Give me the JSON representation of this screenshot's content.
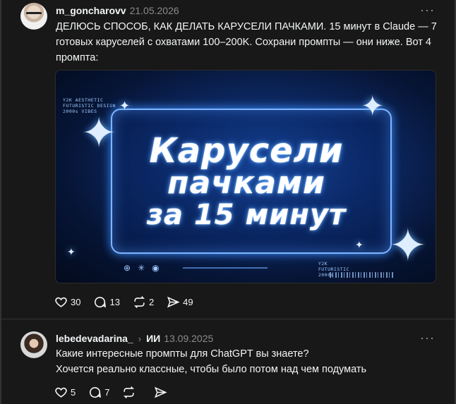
{
  "posts": [
    {
      "username": "m_goncharovv",
      "date": "21.05.2026",
      "text": "ДЕЛЮСЬ СПОСОБ, КАК ДЕЛАТЬ КАРУСЕЛИ ПАЧКАМИ. 15 минут в Claude — 7 готовых каруселей с охватами 100–200K. Сохрани промпты — они ниже. Вот 4 промпта:",
      "image": {
        "caption_top": "Y2K AESTHETIC\nFUTURISTIC DESIGN\n2000s VIBES",
        "line1": "Карусели",
        "line2": "пачками",
        "line3": "за 15 минут",
        "caption_bottom": "Y2K\nFUTURISTIC\n2000s"
      },
      "actions": {
        "likes": "30",
        "comments": "13",
        "reposts": "2",
        "shares": "49"
      }
    },
    {
      "username": "lebedevadarina_",
      "reply_to": "ИИ",
      "date": "13.09.2025",
      "text_line1": "Какие интересные промпты для ChatGPT вы знаете?",
      "text_line2": "Хочется реально классные, чтобы было потом над чем подумать",
      "actions": {
        "likes": "5",
        "comments": "7",
        "reposts": "",
        "shares": ""
      }
    }
  ],
  "icons": {
    "more": "more-horizontal-icon",
    "like": "heart-icon",
    "comment": "comment-icon",
    "repost": "repost-icon",
    "share": "send-icon"
  },
  "colors": {
    "background": "#181818",
    "text": "#f3f5f7",
    "muted": "#8a8a8a",
    "accent_glow": "#5aa3ff"
  }
}
